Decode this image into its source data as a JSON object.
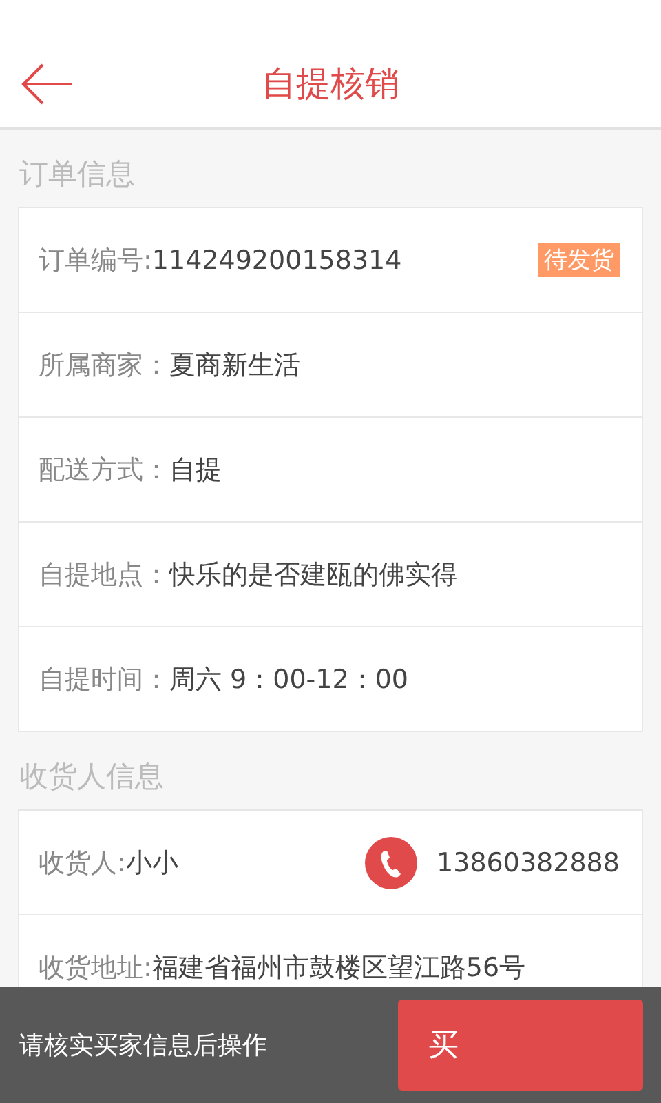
{
  "header": {
    "title": "自提核销"
  },
  "order_section": {
    "title": "订单信息",
    "rows": [
      {
        "label": "订单编号:",
        "value": "114249200158314",
        "badge": "待发货"
      },
      {
        "label": "所属商家：",
        "value": "夏商新生活"
      },
      {
        "label": "配送方式：",
        "value": "自提"
      },
      {
        "label": "自提地点：",
        "value": "快乐的是否建瓯的佛实得"
      },
      {
        "label": "自提时间：",
        "value": "周六 9：00-12：00"
      }
    ]
  },
  "consignee_section": {
    "title": "收货人信息",
    "name_label": "收货人:",
    "name": "小小",
    "phone": "13860382888",
    "address_label": "收货地址:",
    "address": "福建省福州市鼓楼区望江路56号"
  },
  "bottom_bar": {
    "hint": "请核实买家信息后操作",
    "button": "买"
  }
}
